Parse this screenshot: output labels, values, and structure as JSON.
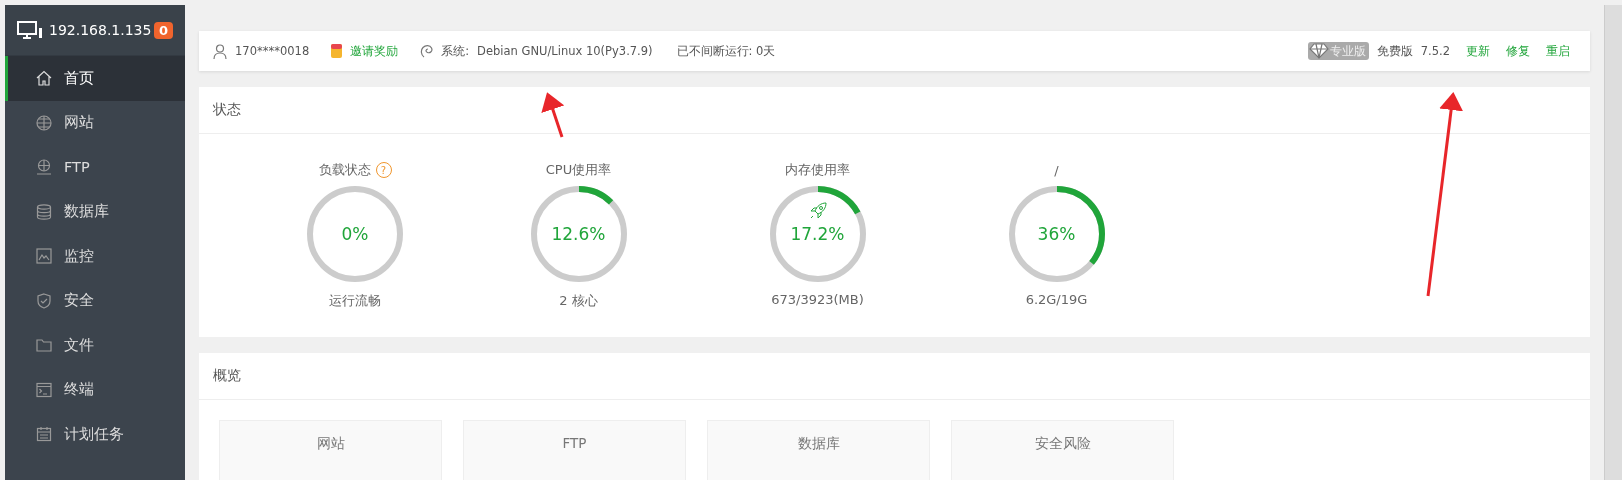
{
  "sidebar": {
    "host": "192.168.1.135",
    "badge": "0",
    "items": [
      {
        "label": "首页",
        "kind": "home",
        "selected": true
      },
      {
        "label": "网站",
        "kind": "globe",
        "selected": false
      },
      {
        "label": "FTP",
        "kind": "ftp",
        "selected": false
      },
      {
        "label": "数据库",
        "kind": "database",
        "selected": false
      },
      {
        "label": "监控",
        "kind": "monitor",
        "selected": false
      },
      {
        "label": "安全",
        "kind": "shield",
        "selected": false
      },
      {
        "label": "文件",
        "kind": "folder",
        "selected": false
      },
      {
        "label": "终端",
        "kind": "terminal",
        "selected": false
      },
      {
        "label": "计划任务",
        "kind": "calendar",
        "selected": false
      }
    ]
  },
  "topbar": {
    "user": "170****0018",
    "invite": "邀请奖励",
    "system_label": "系统:",
    "system": "Debian GNU/Linux 10(Py3.7.9)",
    "uptime": "已不间断运行: 0天",
    "pro_badge": "专业版",
    "edition": "免费版",
    "version": "7.5.2",
    "actions": [
      "更新",
      "修复",
      "重启"
    ]
  },
  "status": {
    "title": "状态",
    "gauges": [
      {
        "kind": "load",
        "title": "负载状态",
        "help": "?",
        "value": "0%",
        "level": 0,
        "subtitle": "运行流畅"
      },
      {
        "kind": "cpu",
        "title": "CPU使用率",
        "value": "12.6%",
        "level": 0.126,
        "subtitle": "2 核心"
      },
      {
        "kind": "memory",
        "title": "内存使用率",
        "value": "17.2%",
        "level": 0.172,
        "subtitle": "673/3923(MB)"
      },
      {
        "kind": "disk",
        "title": "/",
        "value": "36%",
        "level": 0.36,
        "subtitle": "6.2G/19G"
      }
    ]
  },
  "overview": {
    "title": "概览",
    "cards": [
      "网站",
      "FTP",
      "数据库",
      "安全风险"
    ]
  }
}
